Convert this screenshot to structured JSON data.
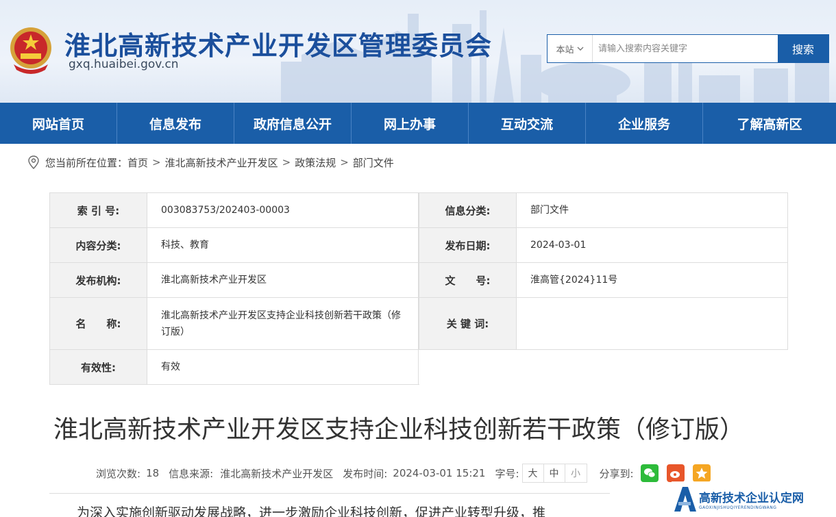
{
  "header": {
    "site_title": "淮北高新技术产业开发区管理委员会",
    "site_domain": "gxq.huaibei.gov.cn",
    "search_scope": "本站",
    "search_placeholder": "请输入搜索内容关键字",
    "search_button": "搜索",
    "brand_color": "#1a5ea8"
  },
  "nav": {
    "items": [
      "网站首页",
      "信息发布",
      "政府信息公开",
      "网上办事",
      "互动交流",
      "企业服务",
      "了解高新区"
    ]
  },
  "breadcrumb": {
    "prefix": "您当前所在位置：",
    "items": [
      "首页",
      "淮北高新技术产业开发区",
      "政策法规",
      "部门文件"
    ],
    "separator": ">"
  },
  "meta": {
    "index_label": "索 引 号:",
    "index_value": "003083753/202403-00003",
    "category_label": "信息分类:",
    "category_value": "部门文件",
    "content_label": "内容分类:",
    "content_value": "科技、教育",
    "date_label": "发布日期:",
    "date_value": "2024-03-01",
    "org_label": "发布机构:",
    "org_value": "淮北高新技术产业开发区",
    "doc_label": "文　　号:",
    "doc_value": "淮高管{2024}11号",
    "name_label": "名　　称:",
    "name_value": "淮北高新技术产业开发区支持企业科技创新若干政策（修订版）",
    "keyword_label": "关 键 词:",
    "keyword_value": "",
    "validity_label": "有效性:",
    "validity_value": "有效"
  },
  "article": {
    "title": "淮北高新技术产业开发区支持企业科技创新若干政策（修订版）",
    "views_label": "浏览次数:",
    "views_value": "18",
    "source_label": "信息来源:",
    "source_value": "淮北高新技术产业开发区",
    "time_label": "发布时间:",
    "time_value": "2024-03-01 15:21",
    "font_label": "字号:",
    "font_sizes": [
      "大",
      "中",
      "小"
    ],
    "share_label": "分享到:",
    "share_icons": [
      "wechat-icon",
      "weibo-icon",
      "qzone-icon"
    ],
    "body_first_line": "为深入实施创新驱动发展战略，进一步激励企业科技创新，促进产业转型升级，推"
  },
  "watermark": {
    "main": "高新技术企业认定网",
    "sub": "GAOXINJISHUQIYERENDINGWANG"
  }
}
